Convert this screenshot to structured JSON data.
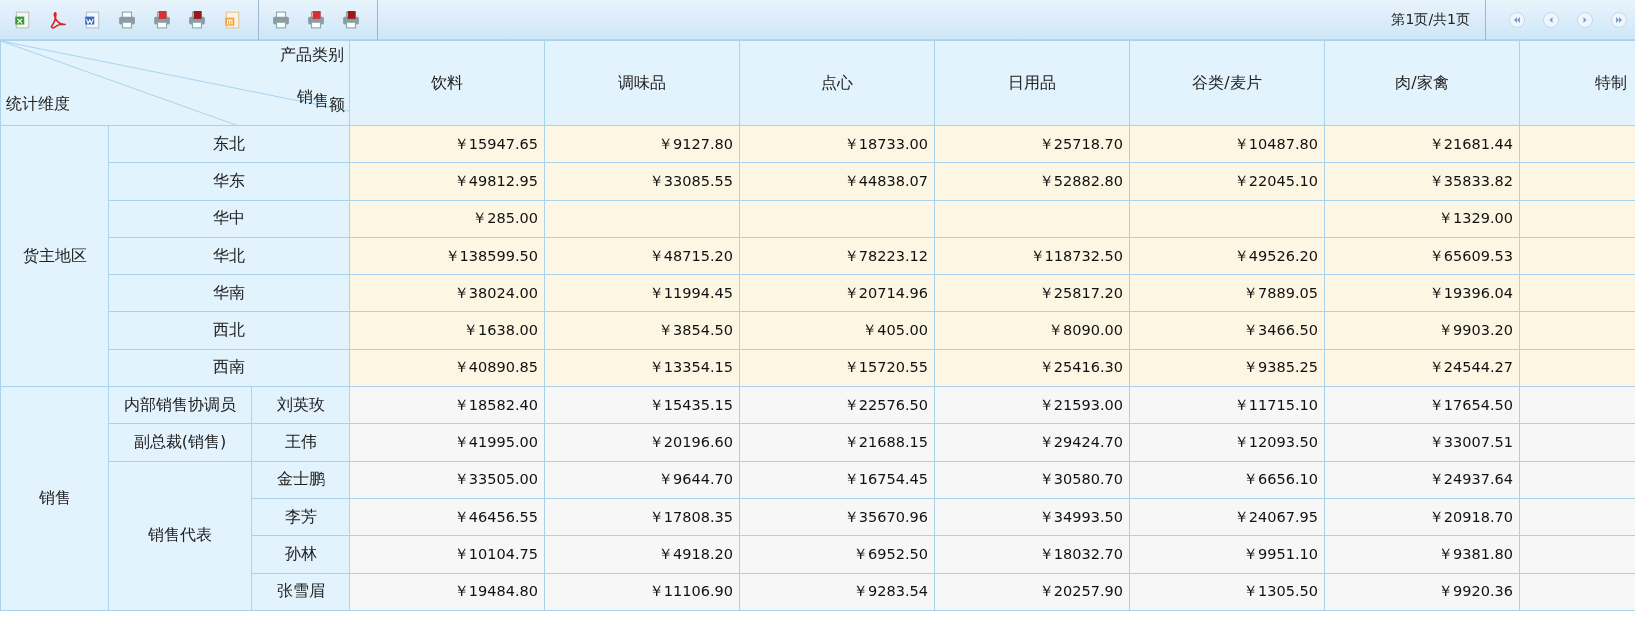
{
  "toolbar": {
    "groups": [
      [
        {
          "kind": "excel"
        },
        {
          "kind": "pdf"
        },
        {
          "kind": "word"
        },
        {
          "kind": "print"
        },
        {
          "kind": "print-red"
        },
        {
          "kind": "print-dark"
        },
        {
          "kind": "orange-doc"
        }
      ],
      [
        {
          "kind": "print"
        },
        {
          "kind": "print-red"
        },
        {
          "kind": "print-dark"
        }
      ]
    ],
    "page_info": "第1页/共1页",
    "nav": [
      {
        "kind": "first"
      },
      {
        "kind": "prev"
      },
      {
        "kind": "next"
      },
      {
        "kind": "last"
      }
    ]
  },
  "table": {
    "corner": {
      "column_title": "产品类别",
      "value_title": "销售额",
      "row_title": "统计维度"
    },
    "columns": [
      "饮料",
      "调味品",
      "点心",
      "日用品",
      "谷类/麦片",
      "肉/家禽",
      "特制"
    ],
    "groups": [
      {
        "label": "货主地区",
        "kind": "region",
        "rows": [
          {
            "label": "东北",
            "values": [
              "￥15947.65",
              "￥9127.80",
              "￥18733.00",
              "￥25718.70",
              "￥10487.80",
              "￥21681.44"
            ]
          },
          {
            "label": "华东",
            "values": [
              "￥49812.95",
              "￥33085.55",
              "￥44838.07",
              "￥52882.80",
              "￥22045.10",
              "￥35833.82"
            ]
          },
          {
            "label": "华中",
            "values": [
              {
                "kind": "amount",
                "text": "￥285.00"
              },
              {
                "kind": "blank"
              },
              {
                "kind": "blank"
              },
              {
                "kind": "blank"
              },
              {
                "kind": "blank"
              },
              {
                "kind": "amount",
                "text": "￥1329.00"
              }
            ]
          },
          {
            "label": "华北",
            "values": [
              "￥138599.50",
              "￥48715.20",
              "￥78223.12",
              "￥118732.50",
              "￥49526.20",
              "￥65609.53"
            ]
          },
          {
            "label": "华南",
            "values": [
              "￥38024.00",
              "￥11994.45",
              "￥20714.96",
              "￥25817.20",
              "￥7889.05",
              "￥19396.04"
            ]
          },
          {
            "label": "西北",
            "values": [
              "￥1638.00",
              "￥3854.50",
              "￥405.00",
              "￥8090.00",
              "￥3466.50",
              "￥9903.20"
            ]
          },
          {
            "label": "西南",
            "values": [
              "￥40890.85",
              "￥13354.15",
              "￥15720.55",
              "￥25416.30",
              "￥9385.25",
              "￥24544.27"
            ]
          }
        ]
      },
      {
        "label": "销售",
        "kind": "staff",
        "subgroups": [
          {
            "label": "内部销售协调员",
            "rows": [
              {
                "label": "刘英玫",
                "values": [
                  "￥18582.40",
                  "￥15435.15",
                  "￥22576.50",
                  "￥21593.00",
                  "￥11715.10",
                  "￥17654.50"
                ]
              }
            ]
          },
          {
            "label": "副总裁(销售)",
            "rows": [
              {
                "label": "王伟",
                "values": [
                  "￥41995.00",
                  "￥20196.60",
                  "￥21688.15",
                  "￥29424.70",
                  "￥12093.50",
                  "￥33007.51"
                ]
              }
            ]
          },
          {
            "label": "销售代表",
            "rows": [
              {
                "label": "金士鹏",
                "values": [
                  "￥33505.00",
                  "￥9644.70",
                  "￥16754.45",
                  "￥30580.70",
                  "￥6656.10",
                  "￥24937.64"
                ]
              },
              {
                "label": "李芳",
                "values": [
                  "￥46456.55",
                  "￥17808.35",
                  "￥35670.96",
                  "￥34993.50",
                  "￥24067.95",
                  "￥20918.70"
                ]
              },
              {
                "label": "孙林",
                "values": [
                  "￥10104.75",
                  "￥4918.20",
                  "￥6952.50",
                  "￥18032.70",
                  "￥9951.10",
                  "￥9381.80"
                ]
              },
              {
                "label": "张雪眉",
                "values": [
                  "￥19484.80",
                  "￥11106.90",
                  "￥9283.54",
                  "￥20257.90",
                  "￥1305.50",
                  "￥9920.36"
                ]
              }
            ]
          }
        ]
      }
    ]
  }
}
